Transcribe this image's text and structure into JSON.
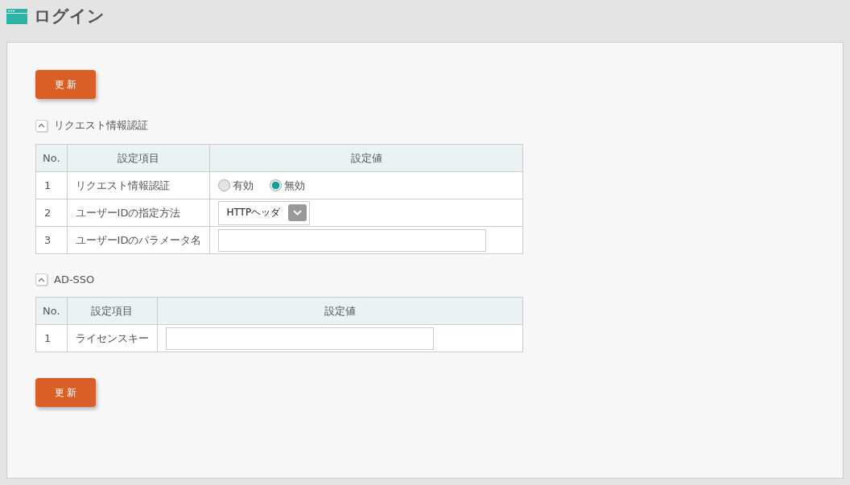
{
  "page": {
    "title": "ログイン"
  },
  "top_button": "更 新",
  "sections": [
    {
      "title": "リクエスト情報認証",
      "expanded": true,
      "columns": [
        "No.",
        "設定項目",
        "設定値"
      ],
      "rows": [
        {
          "no": "1",
          "item": "リクエスト情報認証",
          "kind": "radio",
          "options": [
            {
              "label": "有効",
              "selected": false
            },
            {
              "label": "無効",
              "selected": true
            }
          ]
        },
        {
          "no": "2",
          "item": "ユーザーIDの指定方法",
          "kind": "select",
          "value": "HTTPヘッダ"
        },
        {
          "no": "3",
          "item": "ユーザーIDのパラメータ名",
          "kind": "text"
        }
      ]
    },
    {
      "title": "AD-SSO",
      "expanded": true,
      "columns": [
        "No.",
        "設定項目",
        "設定値"
      ],
      "rows": [
        {
          "no": "1",
          "item": "ライセンスキー",
          "kind": "text"
        }
      ]
    }
  ],
  "bottom_button": "更 新"
}
